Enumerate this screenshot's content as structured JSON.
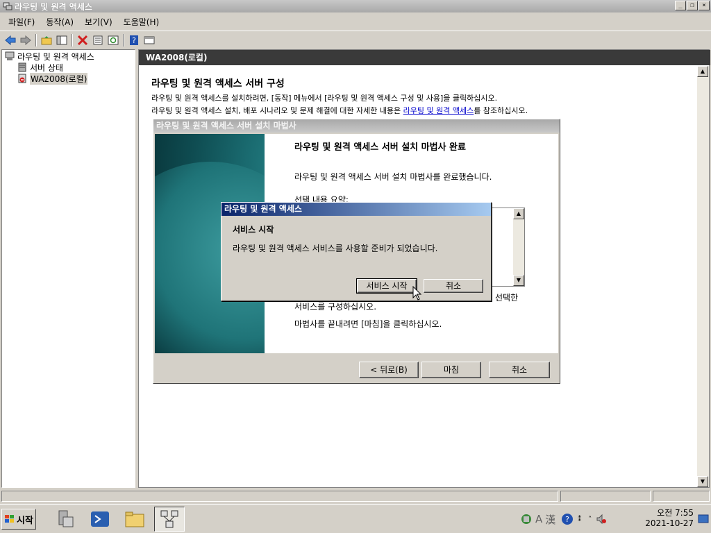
{
  "window": {
    "title": "라우팅 및 원격 액세스",
    "min": "_",
    "max": "❐",
    "close": "×"
  },
  "menu": {
    "items": [
      "파일(F)",
      "동작(A)",
      "보기(V)",
      "도움말(H)"
    ]
  },
  "toolbar": {
    "icons": [
      "back-icon",
      "forward-icon",
      "up-folder-icon",
      "show-hide-tree-icon",
      "delete-icon",
      "properties-icon",
      "refresh-icon",
      "help-icon",
      "console-icon"
    ]
  },
  "tree": {
    "root": "라우팅 및 원격 액세스",
    "items": [
      "서버 상태",
      "WA2008(로컬)"
    ]
  },
  "right_pane": {
    "header": "WA2008(로컬)",
    "title": "라우팅 및 원격 액세스 서버 구성",
    "line1": "라우팅 및 원격 액세스를 설치하려면, [동작] 메뉴에서 [라우팅 및 원격 액세스 구성 및 사용]을 클릭하십시오.",
    "line2_pre": "라우팅 및 원격 액세스 설치, 배포 시나리오 및 문제 해결에 대한 자세한 내용은 ",
    "line2_link": "라우팅 및 원격 액세스",
    "line2_post": "를 참조하십시오."
  },
  "wizard": {
    "title": "라우팅 및 원격 액세스 서버 설치 마법사",
    "heading": "라우팅 및 원격 액세스 서버 설치 마법사 완료",
    "text1": "라우팅 및 원격 액세스 서버 설치 마법사를 완료했습니다.",
    "text2": "선택 내용 요약:",
    "text3": "선택한",
    "text4": "서비스를 구성하십시오.",
    "text5": "마법사를 끝내려면 [마침]을 클릭하십시오.",
    "back_button": "< 뒤로(B)",
    "finish_button": "마침",
    "cancel_button": "취소"
  },
  "dialog": {
    "title": "라우팅 및 원격 액세스",
    "heading": "서비스 시작",
    "message": "라우팅 및 원격 액세스 서비스를 사용할 준비가 되었습니다.",
    "start_button": "서비스 시작",
    "cancel_button": "취소"
  },
  "taskbar": {
    "start_label": "시작",
    "clock_ampm_time": "오전 7:55",
    "clock_date": "2021-10-27"
  },
  "colors": {
    "dialog_title_start": "#0a246a",
    "dialog_title_end": "#a6caf0",
    "pane_header": "#3a3a3a",
    "link": "#0000cc"
  }
}
